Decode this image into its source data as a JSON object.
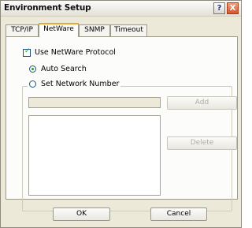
{
  "window": {
    "title": "Environment Setup",
    "help_label": "?",
    "close_label": "X"
  },
  "tabs": [
    {
      "label": "TCP/IP",
      "selected": false
    },
    {
      "label": "NetWare",
      "selected": true
    },
    {
      "label": "SNMP",
      "selected": false
    },
    {
      "label": "Timeout",
      "selected": false
    }
  ],
  "netware": {
    "use_protocol_label": "Use NetWare Protocol",
    "use_protocol_checked": true,
    "auto_search_label": "Auto Search",
    "auto_search_selected": true,
    "set_network_label": "Set Network Number",
    "set_network_selected": false,
    "network_number_value": "",
    "add_label": "Add",
    "delete_label": "Delete",
    "network_list": []
  },
  "footer": {
    "ok_label": "OK",
    "cancel_label": "Cancel"
  },
  "colors": {
    "accent_tab": "#e8a93b",
    "check_green": "#21a121",
    "close_red": "#d9532a"
  }
}
